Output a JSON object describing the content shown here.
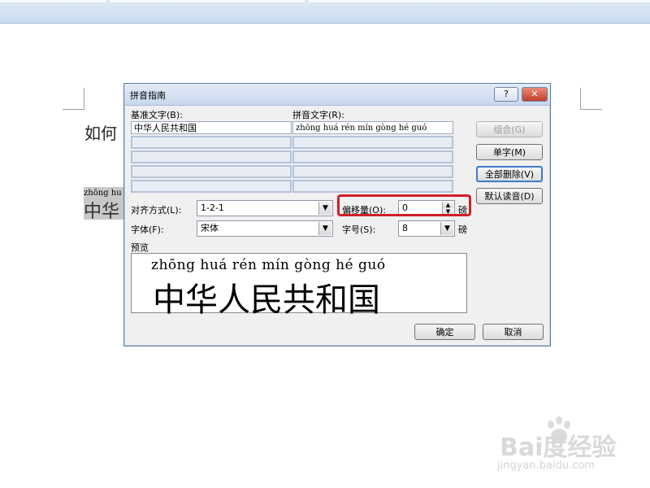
{
  "document": {
    "text_fragment": "如何",
    "selection_pinyin": "zhōng hu",
    "selection_hanzi": "中华"
  },
  "dialog": {
    "title": "拼音指南",
    "help_button": "?",
    "close_button": "✕",
    "base_text_label": "基准文字(B):",
    "ruby_text_label": "拼音文字(R):",
    "rows": [
      {
        "base": "中华人民共和国",
        "ruby": "zhōng huá rén mín gòng hé guó"
      },
      {
        "base": "",
        "ruby": ""
      },
      {
        "base": "",
        "ruby": ""
      },
      {
        "base": "",
        "ruby": ""
      },
      {
        "base": "",
        "ruby": ""
      }
    ],
    "buttons": {
      "group": "组合(G)",
      "single": "单字(M)",
      "clear_all": "全部删除(V)",
      "default_reading": "默认读音(D)",
      "ok": "确定",
      "cancel": "取消"
    },
    "alignment_label": "对齐方式(L):",
    "alignment_value": "1-2-1",
    "offset_label": "偏移量(O):",
    "offset_value": "0",
    "offset_unit": "磅",
    "font_label": "字体(F):",
    "font_value": "宋体",
    "size_label": "字号(S):",
    "size_value": "8",
    "size_unit": "磅",
    "preview_label": "预览",
    "preview_pinyin": "zhōng huá rén mín gòng hé guó",
    "preview_hanzi": "中华人民共和国"
  },
  "watermark": {
    "brand": "Bai度经验",
    "url": "jingyan.baidu.com"
  },
  "colors": {
    "highlight_border": "#d21e2a",
    "title_gradient": "#c7d8ee"
  }
}
